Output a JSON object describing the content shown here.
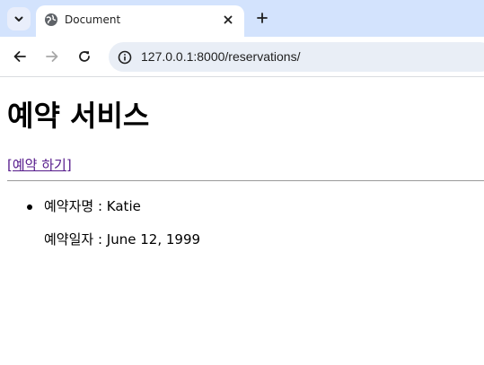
{
  "browser": {
    "tab": {
      "title": "Document"
    },
    "address_bar": {
      "url": "127.0.0.1:8000/reservations/"
    },
    "icons": {
      "tab_search": "chevron-down-icon",
      "favicon": "globe-icon",
      "close": "close-icon",
      "new_tab": "plus-icon",
      "back": "arrow-left-icon",
      "forward": "arrow-right-icon",
      "reload": "reload-icon",
      "site_info": "info-icon"
    }
  },
  "page": {
    "title": "예약 서비스",
    "reserve_link": "[예약 하기]",
    "reservations": [
      {
        "name_label": "예약자명",
        "separator": " : ",
        "name": "Katie",
        "date_label": "예약일자",
        "date": "June 12, 1999"
      }
    ]
  },
  "colors": {
    "tabstrip_bg": "#d3e3fd",
    "omnibox_bg": "#e9eef6",
    "visited_link": "#551a8b",
    "disabled_icon": "#a8a8a8"
  }
}
